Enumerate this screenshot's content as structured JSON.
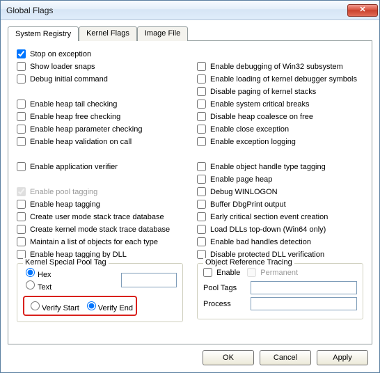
{
  "window": {
    "title": "Global Flags"
  },
  "tabs": [
    {
      "label": "System Registry",
      "active": true
    },
    {
      "label": "Kernel Flags",
      "active": false
    },
    {
      "label": "Image File",
      "active": false
    }
  ],
  "left_col": {
    "stop_exception": "Stop on exception",
    "show_loader": "Show loader snaps",
    "debug_initial": "Debug initial command",
    "heap_tail": "Enable heap tail checking",
    "heap_free": "Enable heap free checking",
    "heap_param": "Enable heap parameter checking",
    "heap_valid": "Enable heap validation on call",
    "app_verifier": "Enable application verifier",
    "pool_tagging": "Enable pool tagging",
    "heap_tagging": "Enable heap tagging",
    "user_mode_db": "Create user mode stack trace database",
    "kernel_mode_db": "Create kernel mode stack trace database",
    "maintain_list": "Maintain a list of objects for each type",
    "heap_tag_dll": "Enable heap tagging by DLL"
  },
  "right_col": {
    "win32_debug": "Enable debugging of Win32 subsystem",
    "kernel_dbg_sym": "Enable loading of kernel debugger symbols",
    "disable_paging": "Disable paging of kernel stacks",
    "sys_crit_break": "Enable system critical breaks",
    "disable_coalesce": "Disable heap coalesce on free",
    "close_exception": "Enable close exception",
    "exception_log": "Enable exception logging",
    "handle_type_tag": "Enable object handle type tagging",
    "page_heap": "Enable page heap",
    "debug_winlogon": "Debug WINLOGON",
    "buffer_dbgprint": "Buffer DbgPrint output",
    "early_crit": "Early critical section event creation",
    "load_dll_topdown": "Load DLLs top-down (Win64 only)",
    "bad_handles": "Enable bad handles detection",
    "disable_dll_verify": "Disable protected DLL verification"
  },
  "kernel_pool": {
    "legend": "Kernel Special Pool Tag",
    "hex": "Hex",
    "text": "Text",
    "text_value": "",
    "verify_start": "Verify Start",
    "verify_end": "Verify End"
  },
  "ort": {
    "legend": "Object Reference Tracing",
    "enable": "Enable",
    "permanent": "Permanent",
    "pool_tags_label": "Pool Tags",
    "pool_tags_value": "",
    "process_label": "Process",
    "process_value": ""
  },
  "buttons": {
    "ok": "OK",
    "cancel": "Cancel",
    "apply": "Apply"
  },
  "checked": {
    "stop_exception": true,
    "pool_tagging": true
  }
}
